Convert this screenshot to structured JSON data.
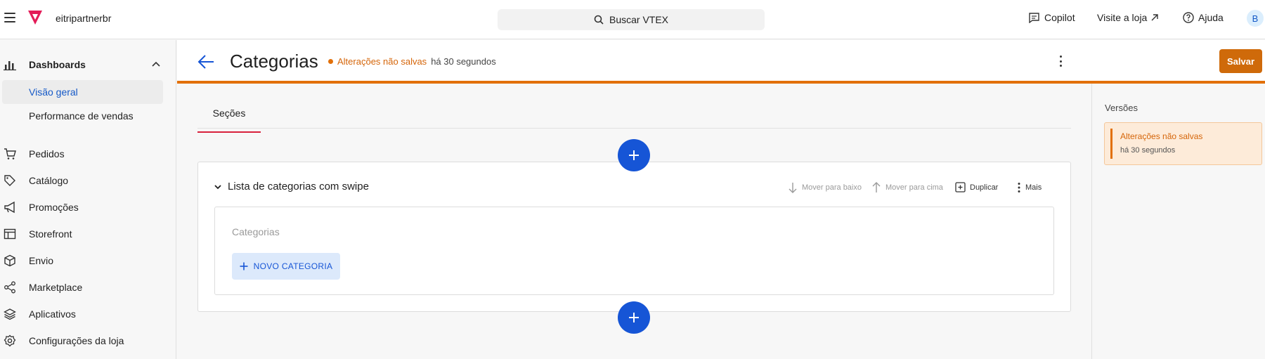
{
  "topbar": {
    "account": "eitripartnerbr",
    "search_label": "Buscar VTEX",
    "copilot": "Copilot",
    "visit_store": "Visite a loja",
    "help": "Ajuda",
    "avatar_initial": "B",
    "brand_color": "#e31c58"
  },
  "sidebar": {
    "dashboards": "Dashboards",
    "sub_items": [
      "Visão geral",
      "Performance de vendas"
    ],
    "items": [
      "Pedidos",
      "Catálogo",
      "Promoções",
      "Storefront",
      "Envio",
      "Marketplace",
      "Aplicativos",
      "Configurações da loja"
    ]
  },
  "page": {
    "title": "Categorias",
    "unsaved_label": "Alterações não salvas",
    "unsaved_time": "há 30 segundos",
    "save_label": "Salvar",
    "tab": "Seções",
    "accent_color": "#e27009"
  },
  "block": {
    "title": "Lista de categorias com swipe",
    "actions": {
      "move_down": "Mover para baixo",
      "move_up": "Mover para cima",
      "duplicate": "Duplicar",
      "more": "Mais"
    },
    "field_label": "Categorias",
    "new_button": "NOVO CATEGORIA"
  },
  "versions": {
    "title": "Versões",
    "card_title": "Alterações não salvas",
    "card_time": "há 30 segundos"
  }
}
